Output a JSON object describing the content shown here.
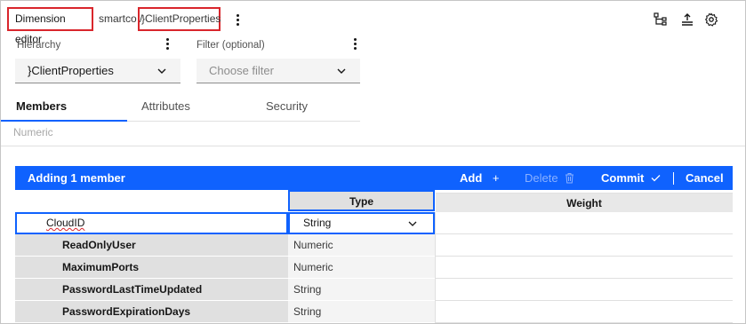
{
  "header": {
    "editor_label": "Dimension editor",
    "path_prefix": "smartco /",
    "dimension_name": "}ClientProperties"
  },
  "icons": {
    "hierarchy": "hierarchy-icon",
    "upload": "upload-icon",
    "settings": "settings-gear-icon"
  },
  "hierarchy": {
    "label": "Hierarchy",
    "value": "}ClientProperties"
  },
  "filter": {
    "label": "Filter (optional)",
    "placeholder": "Choose filter"
  },
  "tabs": [
    {
      "label": "Members",
      "active": true
    },
    {
      "label": "Attributes",
      "active": false
    },
    {
      "label": "Security",
      "active": false
    }
  ],
  "type_hint": "Numeric",
  "grid": {
    "status": "Adding 1 member",
    "add_label": "Add",
    "delete_label": "Delete",
    "commit_label": "Commit",
    "cancel_label": "Cancel",
    "columns": {
      "type": "Type",
      "weight": "Weight"
    },
    "new_member": {
      "name": "CloudID",
      "type": "String"
    },
    "rows": [
      {
        "name": "ReadOnlyUser",
        "type": "Numeric"
      },
      {
        "name": "MaximumPorts",
        "type": "Numeric"
      },
      {
        "name": "PasswordLastTimeUpdated",
        "type": "String"
      },
      {
        "name": "PasswordExpirationDays",
        "type": "String"
      }
    ]
  },
  "colors": {
    "accent": "#0f62fe",
    "highlight_border": "#d9262c"
  }
}
